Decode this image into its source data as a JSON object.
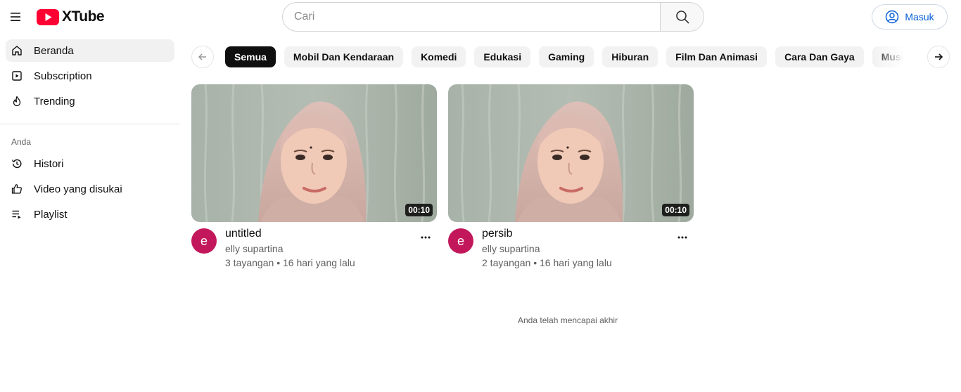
{
  "header": {
    "brand": "XTube",
    "search_placeholder": "Cari",
    "login_label": "Masuk",
    "accent_color": "#ff0033",
    "link_color": "#065fd4"
  },
  "sidebar": {
    "main": [
      {
        "label": "Beranda",
        "icon": "home-icon",
        "active": true
      },
      {
        "label": "Subscription",
        "icon": "subscription-icon"
      },
      {
        "label": "Trending",
        "icon": "flame-icon"
      }
    ],
    "section_title": "Anda",
    "you": [
      {
        "label": "Histori",
        "icon": "history-icon"
      },
      {
        "label": "Video yang disukai",
        "icon": "thumbs-up-icon"
      },
      {
        "label": "Playlist",
        "icon": "playlist-icon"
      }
    ]
  },
  "chips": [
    "Semua",
    "Mobil Dan Kendaraan",
    "Komedi",
    "Edukasi",
    "Gaming",
    "Hiburan",
    "Film Dan Animasi",
    "Cara Dan Gaya",
    "Musik"
  ],
  "videos": [
    {
      "title": "untitled",
      "channel": "elly supartina",
      "avatar_letter": "e",
      "duration": "00:10",
      "views": "3 tayangan",
      "age": "16 hari yang lalu"
    },
    {
      "title": "persib",
      "channel": "elly supartina",
      "avatar_letter": "e",
      "duration": "00:10",
      "views": "2 tayangan",
      "age": "16 hari yang lalu"
    }
  ],
  "end_message": "Anda telah mencapai akhir"
}
